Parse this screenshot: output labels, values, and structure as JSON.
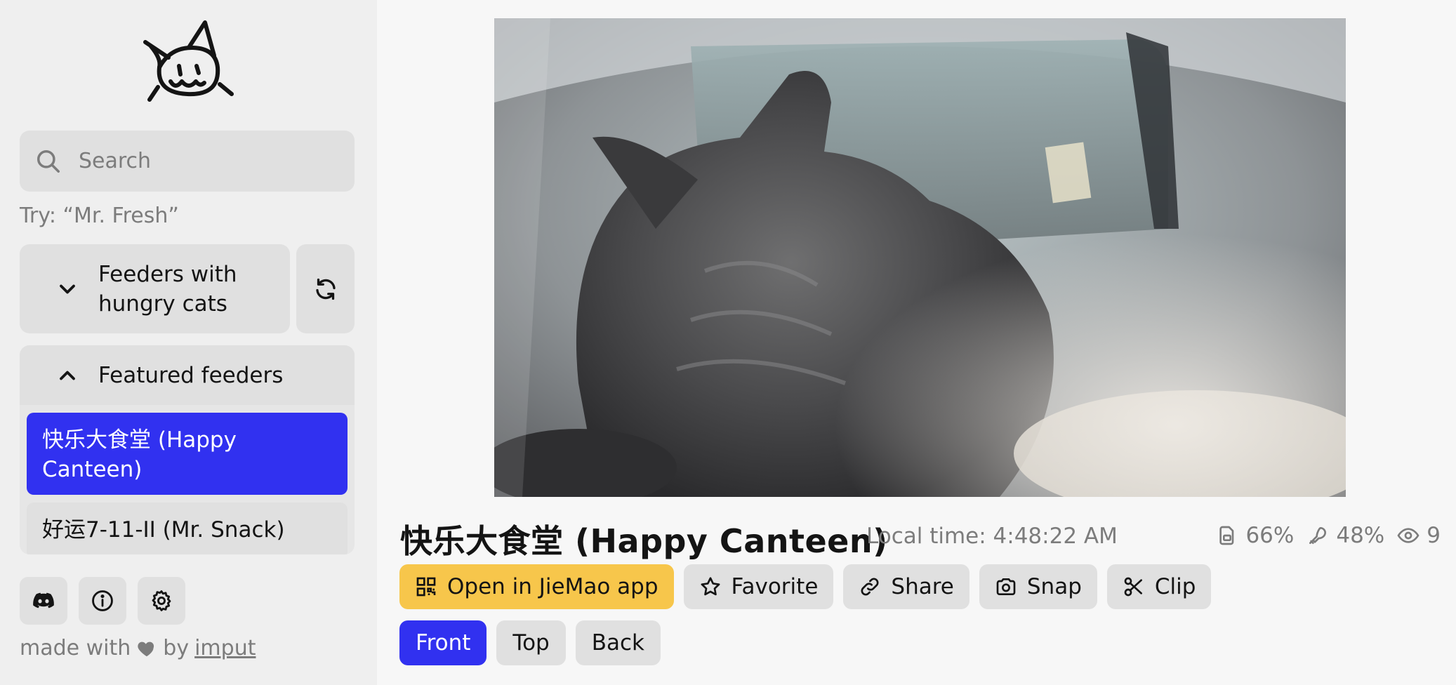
{
  "sidebar": {
    "search": {
      "placeholder": "Search"
    },
    "try_hint": "Try: “Mr. Fresh”",
    "sections": {
      "hungry": {
        "label": "Feeders with hungry cats",
        "expanded": false
      },
      "featured": {
        "label": "Featured feeders",
        "expanded": true
      }
    },
    "feeders": [
      {
        "label": "快乐大食堂 (Happy Canteen)",
        "selected": true
      },
      {
        "label": "好运7-11-II (Mr. Snack)",
        "selected": false
      }
    ],
    "footer": {
      "made_with": "made with",
      "by": "by",
      "author": "imput"
    }
  },
  "feeder": {
    "title": "快乐大食堂 (Happy Canteen)",
    "local_time": "Local time: 4:48:22 AM",
    "stats": {
      "food_level": "66%",
      "battery_level": "48%",
      "viewers": "9"
    }
  },
  "actions": {
    "open_app": "Open in JieMao app",
    "favorite": "Favorite",
    "share": "Share",
    "snap": "Snap",
    "clip": "Clip"
  },
  "cameras": [
    {
      "label": "Front",
      "active": true
    },
    {
      "label": "Top",
      "active": false
    },
    {
      "label": "Back",
      "active": false
    }
  ],
  "colors": {
    "accent": "#3131f0",
    "primary_button": "#f7c64b",
    "sidebar_bg": "#efefef",
    "control_bg": "#e0e0e0",
    "muted_text": "#7c7c7c"
  }
}
